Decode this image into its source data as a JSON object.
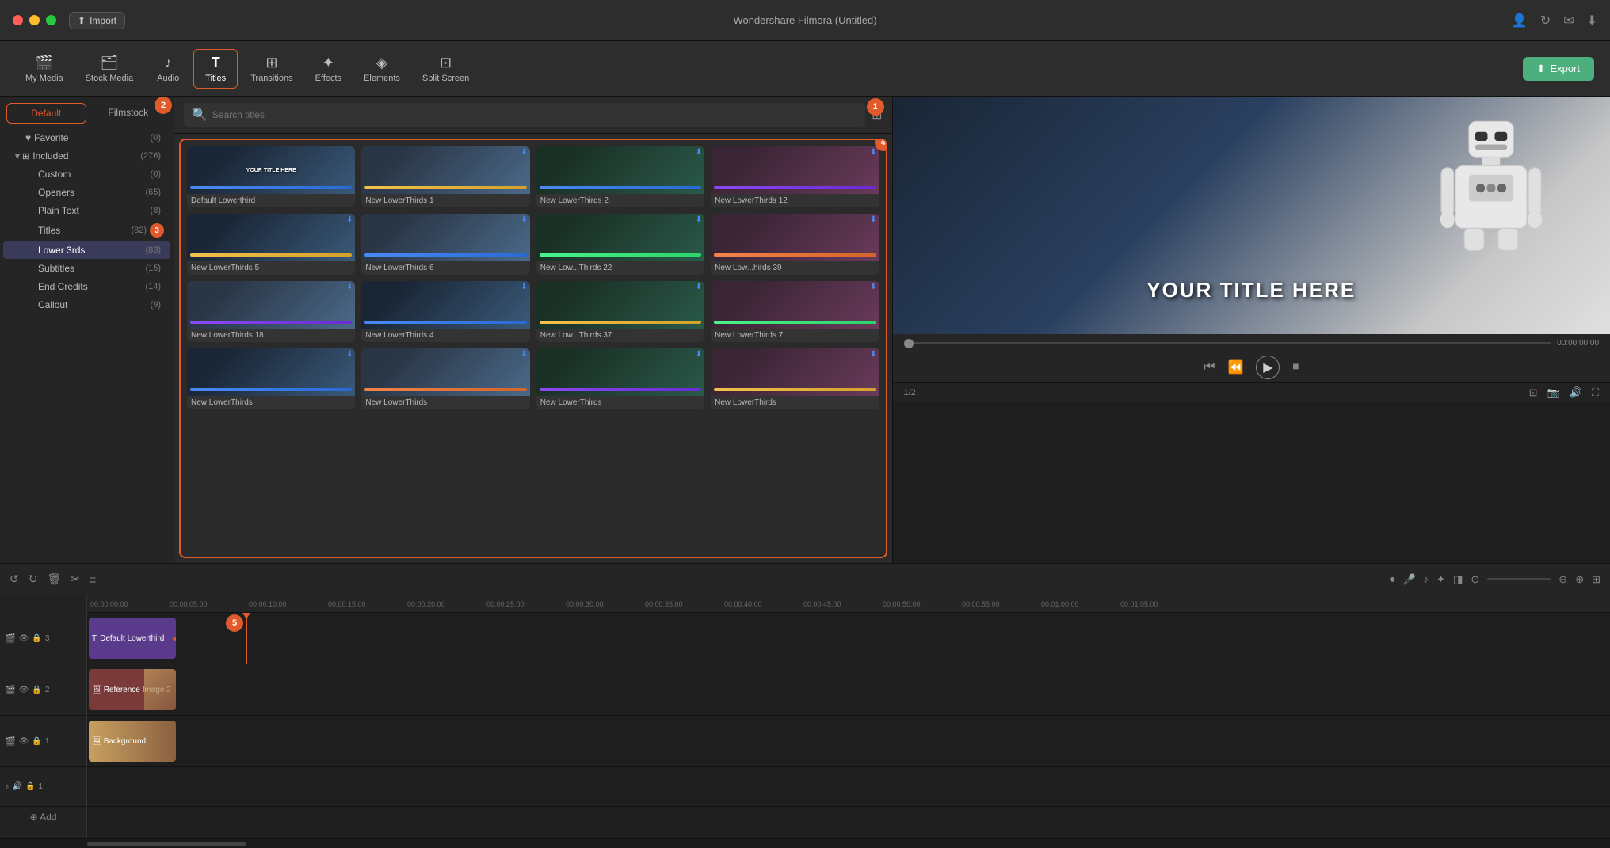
{
  "app": {
    "title": "Wondershare Filmora (Untitled)"
  },
  "titlebar": {
    "import_label": "Import"
  },
  "toolbar": {
    "items": [
      {
        "id": "my-media",
        "label": "My Media",
        "icon": "🎬"
      },
      {
        "id": "stock-media",
        "label": "Stock Media",
        "icon": "🗂"
      },
      {
        "id": "audio",
        "label": "Audio",
        "icon": "♪"
      },
      {
        "id": "titles",
        "label": "Titles",
        "icon": "T",
        "active": true
      },
      {
        "id": "transitions",
        "label": "Transitions",
        "icon": "⊞"
      },
      {
        "id": "effects",
        "label": "Effects",
        "icon": "✦"
      },
      {
        "id": "elements",
        "label": "Elements",
        "icon": "◈"
      },
      {
        "id": "split-screen",
        "label": "Split Screen",
        "icon": "⊡"
      }
    ],
    "export_label": "Export"
  },
  "left_panel": {
    "tabs": [
      {
        "id": "default",
        "label": "Default",
        "active": true
      },
      {
        "id": "filmstock",
        "label": "Filmstock"
      }
    ],
    "tree": [
      {
        "id": "favorite",
        "label": "Favorite",
        "count": "(0)",
        "depth": 0,
        "icon": "♥"
      },
      {
        "id": "included",
        "label": "Included",
        "count": "(276)",
        "depth": 0,
        "expanded": true,
        "badge": 2
      },
      {
        "id": "custom",
        "label": "Custom",
        "count": "(0)",
        "depth": 1
      },
      {
        "id": "openers",
        "label": "Openers",
        "count": "(65)",
        "depth": 1
      },
      {
        "id": "plain-text",
        "label": "Plain Text",
        "count": "(8)",
        "depth": 1
      },
      {
        "id": "titles",
        "label": "Titles",
        "count": "(82)",
        "depth": 1,
        "badge": 3
      },
      {
        "id": "lower-3rds",
        "label": "Lower 3rds",
        "count": "(83)",
        "depth": 1,
        "selected": true
      },
      {
        "id": "subtitles",
        "label": "Subtitles",
        "count": "(15)",
        "depth": 1
      },
      {
        "id": "end-credits",
        "label": "End Credits",
        "count": "(14)",
        "depth": 1
      },
      {
        "id": "callout",
        "label": "Callout",
        "count": "(9)",
        "depth": 1
      }
    ]
  },
  "media_panel": {
    "search_placeholder": "Search titles",
    "cards": [
      {
        "id": "default-lowerthird",
        "label": "Default Lowerthird",
        "strip_color": "blue",
        "thumb_bg": "tp1",
        "has_title": true
      },
      {
        "id": "new-lowerthirds-1",
        "label": "New LowerThirds 1",
        "strip_color": "yellow",
        "thumb_bg": "tp2"
      },
      {
        "id": "new-lowerthirds-2",
        "label": "New LowerThirds 2",
        "strip_color": "blue",
        "thumb_bg": "tp3"
      },
      {
        "id": "new-lowerthirds-12",
        "label": "New LowerThirds 12",
        "strip_color": "purple",
        "thumb_bg": "tp4"
      },
      {
        "id": "new-lowerthirds-5",
        "label": "New LowerThirds 5",
        "strip_color": "yellow",
        "thumb_bg": "tp2"
      },
      {
        "id": "new-lowerthirds-6",
        "label": "New LowerThirds 6",
        "strip_color": "blue",
        "thumb_bg": "tp1"
      },
      {
        "id": "new-lowerthirds-22",
        "label": "New Low...Thirds 22",
        "strip_color": "green",
        "thumb_bg": "tp3"
      },
      {
        "id": "new-lowerthirds-39",
        "label": "New Low...hirds 39",
        "strip_color": "orange",
        "thumb_bg": "tp4"
      },
      {
        "id": "new-lowerthirds-18",
        "label": "New LowerThirds 18",
        "strip_color": "purple",
        "thumb_bg": "tp1"
      },
      {
        "id": "new-lowerthirds-4",
        "label": "New LowerThirds 4",
        "strip_color": "blue",
        "thumb_bg": "tp2"
      },
      {
        "id": "new-lowerthirds-37",
        "label": "New Low...Thirds 37",
        "strip_color": "yellow",
        "thumb_bg": "tp3"
      },
      {
        "id": "new-lowerthirds-7",
        "label": "New LowerThirds 7",
        "strip_color": "green",
        "thumb_bg": "tp4"
      },
      {
        "id": "new-lowerthirds-a",
        "label": "New LowerThirds",
        "strip_color": "blue",
        "thumb_bg": "tp2"
      },
      {
        "id": "new-lowerthirds-b",
        "label": "New LowerThirds",
        "strip_color": "orange",
        "thumb_bg": "tp1"
      },
      {
        "id": "new-lowerthirds-c",
        "label": "New LowerThirds",
        "strip_color": "purple",
        "thumb_bg": "tp3"
      },
      {
        "id": "new-lowerthirds-d",
        "label": "New LowerThirds",
        "strip_color": "yellow",
        "thumb_bg": "tp4"
      }
    ]
  },
  "preview": {
    "title_text": "YOUR TITLE HERE",
    "current_time": "00:00:00:00",
    "zoom_label": "1/2"
  },
  "timeline": {
    "ruler_marks": [
      "00:00:00:00",
      "00:00:05:00",
      "00:00:10:00",
      "00:00:15:00",
      "00:00:20:00",
      "00:00:25:00",
      "00:00:30:00",
      "00:00:35:00",
      "00:00:40:00",
      "00:00:45:00",
      "00:00:50:00",
      "00:00:55:00",
      "00:01:00:00",
      "00:01:05:00"
    ],
    "tracks": [
      {
        "id": "track-3",
        "num": "3",
        "type": "video",
        "clip_label": "Default Lowerthird",
        "clip_color": "title"
      },
      {
        "id": "track-2",
        "num": "2",
        "type": "video",
        "clip_label": "Reference Image 2",
        "clip_color": "ref"
      },
      {
        "id": "track-1",
        "num": "1",
        "type": "video",
        "clip_label": "Background",
        "clip_color": "bg"
      },
      {
        "id": "audio-1",
        "num": "1",
        "type": "audio",
        "clip_label": ""
      }
    ]
  },
  "annotations": {
    "badge_1": "1",
    "badge_2": "2",
    "badge_3": "3",
    "badge_4": "4",
    "badge_5": "5"
  }
}
